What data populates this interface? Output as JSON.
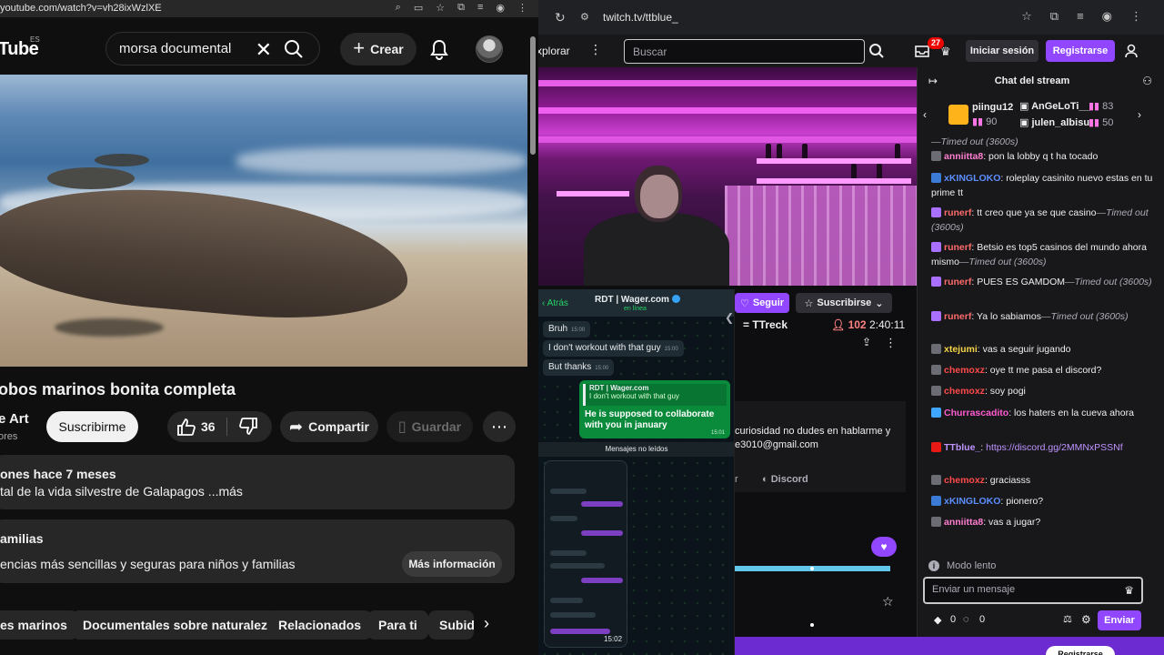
{
  "youtube": {
    "url": "youtube.com/watch?v=vh28ixWzlXE",
    "logo_text": "Tube",
    "logo_country": "ES",
    "search_value": "morsa documental",
    "create_label": "Crear",
    "video_title": "obos marinos bonita completa",
    "channel_name": "e Art",
    "channel_subs": "ores",
    "subscribe_label": "Suscribirme",
    "likes": "36",
    "share_label": "Compartir",
    "save_label": "Guardar",
    "desc_meta": "ones  hace 7 meses",
    "desc_text": "tal de la vida silvestre de Galapagos ...más",
    "info_title": "amilias",
    "info_text": "encias más sencillas y seguras para niños y familias",
    "info_button": "Más información",
    "chips": [
      "es marinos",
      "Documentales sobre naturaleza",
      "Relacionados",
      "Para ti",
      "Subid"
    ]
  },
  "twitch": {
    "url": "twitch.tv/ttblue_",
    "explore_label": "xplorar",
    "search_placeholder": "Buscar",
    "notif_count": "27",
    "login_label": "Iniciar sesión",
    "signup_label": "Registrarse",
    "follow_label": "Seguir",
    "sub_label": "Suscribirse",
    "game": "= TTreck",
    "viewers": "102",
    "uptime": "2:40:11",
    "about_line1": "curiosidad no dudes en hablarme y",
    "about_line2": "e3010@gmail.com",
    "links_r": "r",
    "discord_label": "Discord",
    "register_pill": "Registrarse",
    "whatsapp": {
      "back_label": "Atrás",
      "contact_name": "RDT | Wager.com",
      "status": "en línea",
      "msgs_in": [
        {
          "text": "Bruh",
          "time": "15:00"
        },
        {
          "text": "I don't workout with that guy",
          "time": "15:00"
        },
        {
          "text": "But thanks",
          "time": "15:00"
        }
      ],
      "quote_name": "RDT | Wager.com",
      "quote_text": "I don't workout with that guy",
      "reply_text": "He is supposed to collaborate with you in january",
      "reply_time": "15:01",
      "unread_label": "Mensajes no leídos",
      "screenshot_time": "15:02"
    },
    "chat": {
      "title": "Chat del stream",
      "gifters": [
        {
          "name": "piingu12",
          "count": "90"
        },
        {
          "name": "AnGeLoTi__",
          "count": "83"
        },
        {
          "name": "julen_albisu",
          "count": "50"
        }
      ],
      "top_timeout": "—Timed out (3600s)",
      "messages": [
        {
          "user": "anniitta8",
          "color": "#ff7fd0",
          "badge": "#6c6c75",
          "text": "pon la lobby q t ha tocado",
          "suffix": ""
        },
        {
          "user": "xKINGLOKO",
          "color": "#5c8eff",
          "badge": "#3b7bd6",
          "text": "roleplay casinito nuevo estas en tu prime tt",
          "suffix": ""
        },
        {
          "user": "runerf",
          "color": "#ff6b6b",
          "badge": "#a970ff",
          "text": "tt creo que ya se que casino",
          "suffix": "—Timed out (3600s)"
        },
        {
          "user": "runerf",
          "color": "#ff6b6b",
          "badge": "#a970ff",
          "text": "Betsio es top5 casinos del mundo ahora mismo",
          "suffix": "—Timed out (3600s)"
        },
        {
          "user": "runerf",
          "color": "#ff6b6b",
          "badge": "#a970ff",
          "text": "PUES ES GAMDOM",
          "suffix": "—Timed out (3600s)"
        },
        {
          "user": "runerf",
          "color": "#ff6b6b",
          "badge": "#a970ff",
          "text": "Ya lo sabiamos",
          "suffix": "—Timed out (3600s)"
        },
        {
          "user": "xtejumi",
          "color": "#f5d547",
          "badge": "#6c6c75",
          "text": "vas a seguir jugando",
          "suffix": ""
        },
        {
          "user": "chemoxz",
          "color": "#ff4a4a",
          "badge": "#6c6c75",
          "text": "oye tt me pasa el discord?",
          "suffix": ""
        },
        {
          "user": "chemoxz",
          "color": "#ff4a4a",
          "badge": "#6c6c75",
          "text": "soy pogi",
          "suffix": ""
        },
        {
          "user": "Churrascadito",
          "color": "#ff5cd0",
          "badge": "#3ea6ff",
          "text": "los haters en la cueva ahora",
          "suffix": ""
        },
        {
          "user": "TTblue_",
          "color": "#bf94ff",
          "badge": "#e91916",
          "text": "https://discord.gg/2MMNxPSSNf",
          "suffix": ""
        },
        {
          "user": "chemoxz",
          "color": "#ff4a4a",
          "badge": "#6c6c75",
          "text": "graciasss",
          "suffix": ""
        },
        {
          "user": "xKINGLOKO",
          "color": "#5c8eff",
          "badge": "#3b7bd6",
          "text": "pionero?",
          "suffix": ""
        },
        {
          "user": "anniitta8",
          "color": "#ff7fd0",
          "badge": "#6c6c75",
          "text": "vas a jugar?",
          "suffix": ""
        }
      ],
      "slow_mode": "Modo lento",
      "input_placeholder": "Enviar un mensaje",
      "points_a": "0",
      "points_b": "0",
      "send_label": "Enviar"
    }
  }
}
